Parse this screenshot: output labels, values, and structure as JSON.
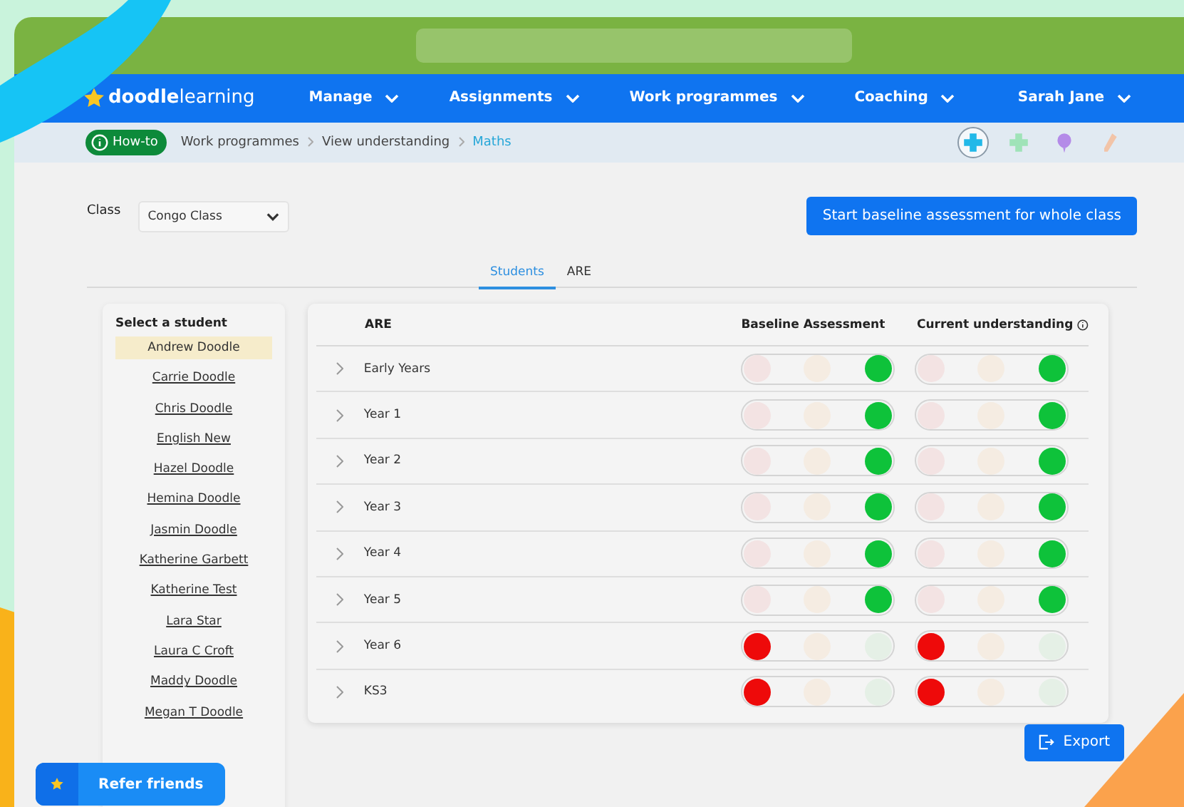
{
  "nav": {
    "logo_bold": "doodle",
    "logo_light": "learning",
    "items": [
      {
        "label": "Manage"
      },
      {
        "label": "Assignments"
      },
      {
        "label": "Work programmes"
      },
      {
        "label": "Coaching"
      }
    ],
    "user": "Sarah Jane"
  },
  "breadcrumb": {
    "howto": "How-to",
    "items": [
      {
        "label": "Work programmes",
        "current": false
      },
      {
        "label": "View understanding",
        "current": false
      },
      {
        "label": "Maths",
        "current": true
      }
    ]
  },
  "tools": [
    {
      "kind": "cross",
      "color": "#22b8e8",
      "selected": true
    },
    {
      "kind": "cross",
      "color": "#9fe3b8",
      "selected": false
    },
    {
      "kind": "balloon",
      "color": "#b48be8",
      "selected": false
    },
    {
      "kind": "pencil",
      "color": "#f2c4a8",
      "selected": false
    }
  ],
  "class_filter": {
    "label": "Class",
    "value": "Congo Class"
  },
  "start_button": "Start baseline assessment for whole class",
  "tabs": [
    {
      "label": "Students",
      "selected": true
    },
    {
      "label": "ARE",
      "selected": false
    }
  ],
  "students": {
    "title": "Select a student",
    "items": [
      {
        "name": "Andrew Doodle",
        "selected": true
      },
      {
        "name": "Carrie Doodle",
        "selected": false
      },
      {
        "name": "Chris Doodle",
        "selected": false
      },
      {
        "name": "English New",
        "selected": false
      },
      {
        "name": "Hazel Doodle",
        "selected": false
      },
      {
        "name": "Hemina Doodle",
        "selected": false
      },
      {
        "name": "Jasmin Doodle",
        "selected": false
      },
      {
        "name": "Katherine Garbett",
        "selected": false
      },
      {
        "name": "Katherine Test",
        "selected": false
      },
      {
        "name": "Lara Star",
        "selected": false
      },
      {
        "name": "Laura C Croft",
        "selected": false
      },
      {
        "name": "Maddy Doodle",
        "selected": false
      },
      {
        "name": "Megan T Doodle",
        "selected": false
      }
    ]
  },
  "table": {
    "columns": [
      "ARE",
      "Baseline Assessment",
      "Current understanding"
    ],
    "rows": [
      {
        "label": "Early Years",
        "baseline": [
          {
            "on": false
          },
          {
            "on": false
          },
          {
            "on": true
          }
        ],
        "current": [
          {
            "on": false
          },
          {
            "on": false
          },
          {
            "on": true
          }
        ]
      },
      {
        "label": "Year 1",
        "baseline": [
          {
            "on": false
          },
          {
            "on": false
          },
          {
            "on": true
          }
        ],
        "current": [
          {
            "on": false
          },
          {
            "on": false
          },
          {
            "on": true
          }
        ]
      },
      {
        "label": "Year 2",
        "baseline": [
          {
            "on": false
          },
          {
            "on": false
          },
          {
            "on": true
          }
        ],
        "current": [
          {
            "on": false
          },
          {
            "on": false
          },
          {
            "on": true
          }
        ]
      },
      {
        "label": "Year 3",
        "baseline": [
          {
            "on": false
          },
          {
            "on": false
          },
          {
            "on": true
          }
        ],
        "current": [
          {
            "on": false
          },
          {
            "on": false
          },
          {
            "on": true
          }
        ]
      },
      {
        "label": "Year 4",
        "baseline": [
          {
            "on": false
          },
          {
            "on": false
          },
          {
            "on": true
          }
        ],
        "current": [
          {
            "on": false
          },
          {
            "on": false
          },
          {
            "on": true
          }
        ]
      },
      {
        "label": "Year 5",
        "baseline": [
          {
            "on": false
          },
          {
            "on": false
          },
          {
            "on": true
          }
        ],
        "current": [
          {
            "on": false
          },
          {
            "on": false
          },
          {
            "on": true
          }
        ]
      },
      {
        "label": "Year 6",
        "baseline": [
          {
            "on": true
          },
          {
            "on": false
          },
          {
            "on": false
          }
        ],
        "current": [
          {
            "on": true
          },
          {
            "on": false
          },
          {
            "on": false
          }
        ]
      },
      {
        "label": "KS3",
        "baseline": [
          {
            "on": true
          },
          {
            "on": false
          },
          {
            "on": false
          }
        ],
        "current": [
          {
            "on": true
          },
          {
            "on": false
          },
          {
            "on": false
          }
        ]
      }
    ]
  },
  "export": "Export",
  "refer": "Refer friends"
}
